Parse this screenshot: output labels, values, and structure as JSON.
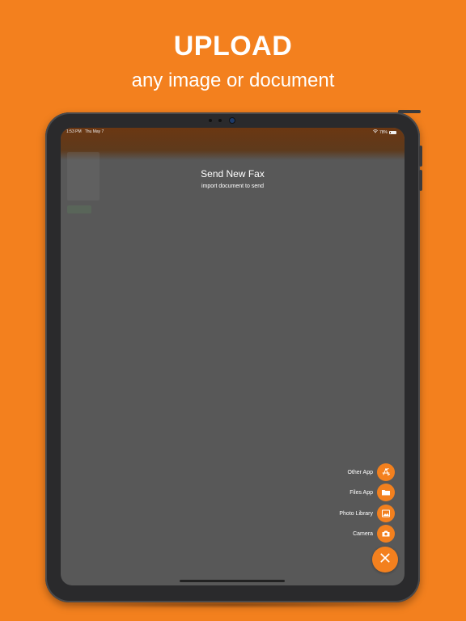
{
  "promo": {
    "headline": "UPLOAD",
    "subheadline": "any image or document"
  },
  "status_bar": {
    "time": "1:53 PM",
    "date": "Thu May 7",
    "battery": "78%"
  },
  "screen": {
    "title": "Send New Fax",
    "subtitle": "import document to send"
  },
  "fab_menu": {
    "items": [
      {
        "label": "Other App",
        "icon": "app-store-icon"
      },
      {
        "label": "Files App",
        "icon": "folder-icon"
      },
      {
        "label": "Photo Library",
        "icon": "photo-icon"
      },
      {
        "label": "Camera",
        "icon": "camera-icon"
      }
    ],
    "close_icon": "close-icon"
  },
  "colors": {
    "accent": "#F3801E",
    "overlay": "#585858",
    "device": "#2a2a2c"
  }
}
